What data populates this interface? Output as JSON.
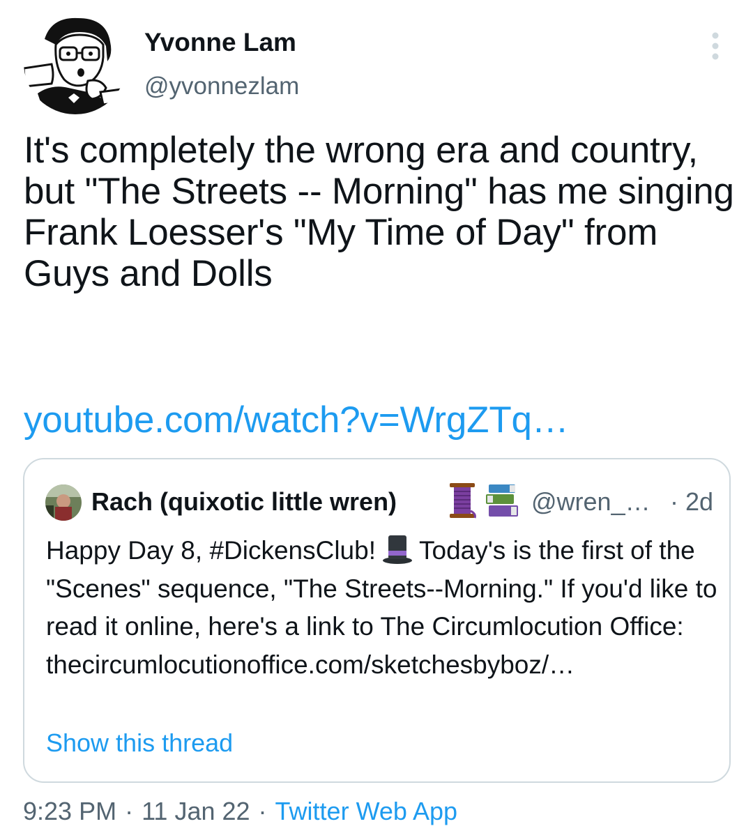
{
  "author": {
    "display_name": "Yvonne Lam",
    "handle": "@yvonnezlam",
    "avatar_icon": "cartoon-avatar-icon"
  },
  "tweet": {
    "text": "It's completely the wrong era and country, but \"The Streets -- Morning\" has me singing Frank Loesser's \"My Time of Day\" from Guys and Dolls",
    "link_text": "youtube.com/watch?v=WrgZTq…"
  },
  "quoted_tweet": {
    "display_name": "Rach (quixotic little wren)",
    "name_emojis": [
      "thread-spool-icon",
      "books-icon"
    ],
    "handle": "@wren_…",
    "separator": "·",
    "age": "2d",
    "text_before_emoji": "Happy Day 8, #DickensClub!",
    "inline_emoji": "top-hat-icon",
    "text_after_emoji": "Today's is the first of the \"Scenes\" sequence, \"The Streets--Morning.\" If you'd like to read it online, here's a link to The Circumlocution Office: thecircumlocutionoffice.com/sketchesbyboz/…",
    "show_thread_label": "Show this thread"
  },
  "meta": {
    "time": "9:23 PM",
    "separator": "·",
    "date": "11 Jan 22",
    "source": "Twitter Web App"
  },
  "colors": {
    "text": "#0f1419",
    "secondary": "#536471",
    "accent": "#1d9bf0",
    "border": "#cfd9de"
  }
}
